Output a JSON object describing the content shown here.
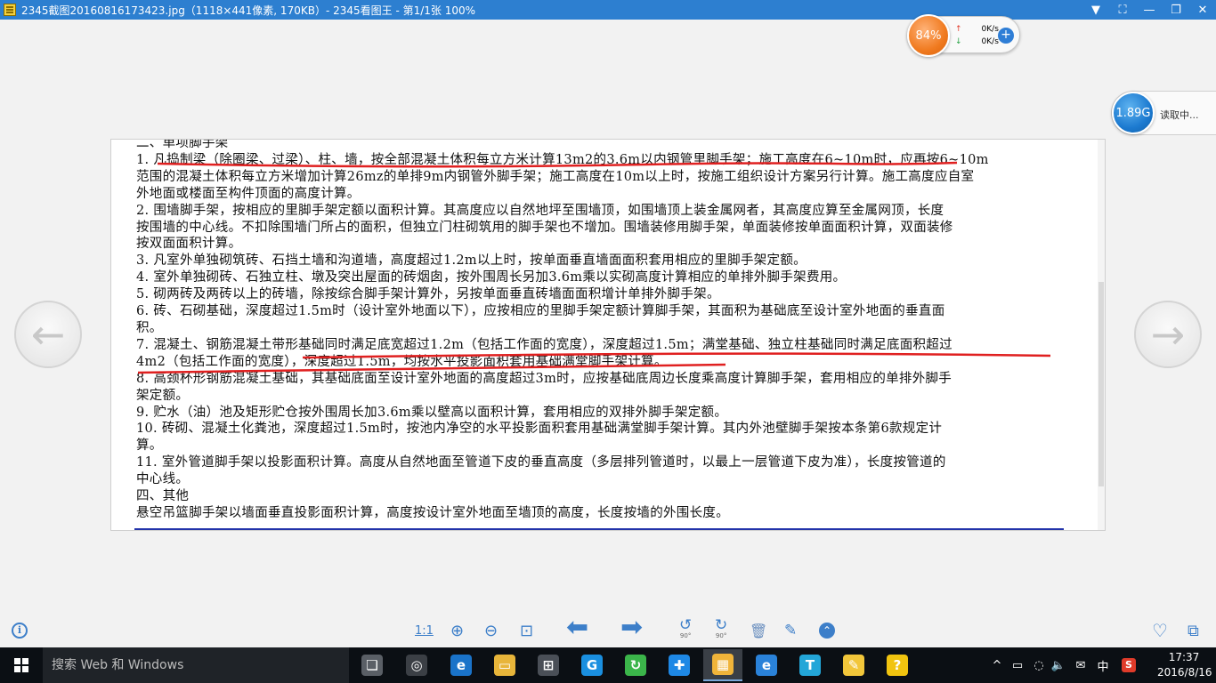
{
  "window": {
    "title": "2345截图20160816173423.jpg（1118×441像素, 170KB）- 2345看图王 - 第1/1张 100%",
    "controls": [
      "▼",
      "⛶",
      "—",
      "❐",
      "✕"
    ]
  },
  "speed_widget": {
    "percent": "84%",
    "upload": "0K/s",
    "download": "0K/s",
    "plus": "+"
  },
  "read_widget": {
    "size": "1.89G",
    "label": "读取中..."
  },
  "document": {
    "lines": [
      "二、单项脚手架",
      "1. 凡捣制梁（除圈梁、过梁）、柱、墙，按全部混凝土体积每立方米计算13m2的3.6m以内钢管里脚手架；施工高度在6~10m时，应再按6~10m",
      "范围的混凝土体积每立方米增加计算26mz的单排9m内钢管外脚手架；施工高度在10m以上时，按施工组织设计方案另行计算。施工高度应自室",
      "外地面或楼面至构件顶面的高度计算。",
      "2. 围墙脚手架，按相应的里脚手架定额以面积计算。其高度应以自然地坪至围墙顶，如围墙顶上装金属网者，其高度应算至金属网顶，长度",
      "按围墙的中心线。不扣除围墙门所占的面积，但独立门柱砌筑用的脚手架也不增加。围墙装修用脚手架，单面装修按单面面积计算，双面装修",
      "按双面面积计算。",
      "3. 凡室外单独砌筑砖、石挡土墙和沟道墙，高度超过1.2m以上时，按单面垂直墙面面积套用相应的里脚手架定额。",
      "4. 室外单独砌砖、石独立柱、墩及突出屋面的砖烟囱，按外围周长另加3.6m乘以实砌高度计算相应的单排外脚手架费用。",
      "5. 砌两砖及两砖以上的砖墙，除按综合脚手架计算外，另按单面垂直砖墙面面积增计单排外脚手架。",
      "6. 砖、石砌基础，深度超过1.5m时（设计室外地面以下），应按相应的里脚手架定额计算脚手架，其面积为基础底至设计室外地面的垂直面",
      "积。",
      "7. 混凝土、钢筋混凝土带形基础同时满足底宽超过1.2m（包括工作面的宽度），深度超过1.5m；满堂基础、独立柱基础同时满足底面积超过",
      "4m2（包括工作面的宽度），深度超过1.5m，均按水平投影面积套用基础满堂脚手架计算。",
      "8. 高颈杯形钢筋混凝土基础，其基础底面至设计室外地面的高度超过3m时，应按基础底周边长度乘高度计算脚手架，套用相应的单排外脚手",
      "架定额。",
      "9. 贮水（油）池及矩形贮仓按外围周长加3.6m乘以壁高以面积计算，套用相应的双排外脚手架定额。",
      "10. 砖砌、混凝土化粪池，深度超过1.5m时，按池内净空的水平投影面积套用基础满堂脚手架计算。其内外池壁脚手架按本条第6款规定计",
      "算。",
      "11. 室外管道脚手架以投影面积计算。高度从自然地面至管道下皮的垂直高度（多层排列管道时，以最上一层管道下皮为准），长度按管道的",
      "中心线。",
      "四、其他",
      "悬空吊篮脚手架以墙面垂直投影面积计算，高度按设计室外地面至墙顶的高度，长度按墙的外围长度。"
    ]
  },
  "nav": {
    "prev": "←",
    "next": "→"
  },
  "toolbar": {
    "info": "i",
    "actual_size": "1:1",
    "zoom_in": "⊕",
    "zoom_out": "⊖",
    "fit": "⊡",
    "prev": "⬅",
    "next": "➡",
    "rotate_left": "↺",
    "rotate_left_label": "90°",
    "rotate_right": "↻",
    "rotate_right_label": "90°",
    "delete": "🗑",
    "edit": "✎",
    "more": "⌃",
    "favorite": "♡",
    "gallery": "⧉"
  },
  "taskbar": {
    "search_placeholder": "搜索 Web 和 Windows",
    "apps": [
      {
        "name": "task-view",
        "glyph": "❏",
        "color": "#5a5f66"
      },
      {
        "name": "browser-2345",
        "glyph": "◎",
        "color": "#3b3f45"
      },
      {
        "name": "edge",
        "glyph": "e",
        "color": "#1a73c9"
      },
      {
        "name": "file-explorer",
        "glyph": "▭",
        "color": "#e8b53a"
      },
      {
        "name": "store",
        "glyph": "⊞",
        "color": "#4a4f57"
      },
      {
        "name": "g-app",
        "glyph": "G",
        "color": "#1a8fe0"
      },
      {
        "name": "green-app",
        "glyph": "↻",
        "color": "#3bb54a"
      },
      {
        "name": "blue-plus-app",
        "glyph": "✚",
        "color": "#1e88e5"
      },
      {
        "name": "image-viewer",
        "glyph": "▦",
        "color": "#f0b43a"
      },
      {
        "name": "ie",
        "glyph": "e",
        "color": "#2a82d9"
      },
      {
        "name": "te-app",
        "glyph": "T",
        "color": "#23a6d8"
      },
      {
        "name": "notes-app",
        "glyph": "✎",
        "color": "#f2c63a"
      },
      {
        "name": "help-app",
        "glyph": "?",
        "color": "#f1c40f"
      }
    ],
    "tray": [
      "^",
      "▭",
      "◌",
      "🔈",
      "✉",
      "中",
      "S"
    ],
    "time": "17:37",
    "date": "2016/8/16"
  },
  "colors": {
    "titlebar": "#2d7fd0",
    "accent": "#3d7fc9",
    "annotation": "#e02020"
  }
}
